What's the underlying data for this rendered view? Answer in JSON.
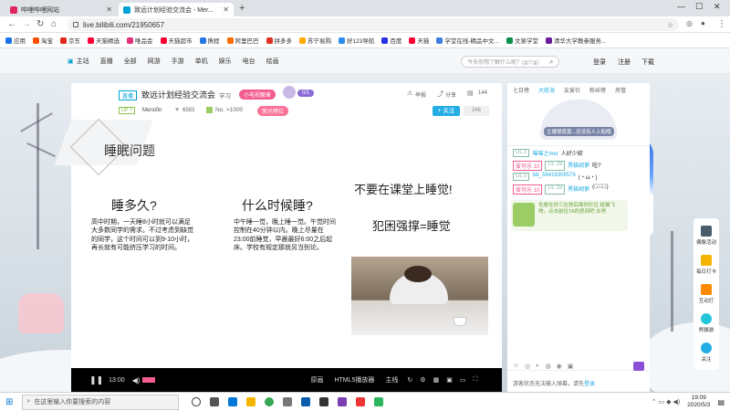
{
  "browser": {
    "tabs": [
      {
        "label": "哔哩哔哩网站",
        "favicon_color": "#e0245e",
        "active": false
      },
      {
        "label": "致远计划经验交流会 - Mer...",
        "favicon_color": "#00a1d6",
        "active": true
      }
    ],
    "new_tab": "+",
    "url": "live.bilibili.com/21950657",
    "bookmarks": [
      "应用",
      "淘宝",
      "京东",
      "天猫精选",
      "唯品会",
      "天猫超市",
      "携程",
      "阿里巴巴",
      "拼多多",
      "苏宁易购",
      "好123导航",
      "百度",
      "天猫",
      "学堂在线-精品中文...",
      "文泉学堂",
      "清华大学教参服务..."
    ]
  },
  "site_header": {
    "home": "主站",
    "links": [
      "直播",
      "全部",
      "网游",
      "手游",
      "单机",
      "娱乐",
      "电台",
      "绘画"
    ],
    "search_placeholder": "今天你想了解什么呢？(≧▽≦)",
    "login": "登录",
    "register": "注册",
    "download": "下载"
  },
  "room": {
    "tag": "直播",
    "title": "致远计划经验交流会",
    "category": "学习",
    "small_badge": "小电视徽章",
    "fan_count_label": "0/1",
    "report": "举报",
    "share": "分享",
    "share_count": "144",
    "up_level": "UP 7",
    "uploader": "Mersi0n",
    "fans": "6583",
    "rank": "No. >1000",
    "hot_label": "荣光榜位",
    "follow": "关注",
    "follow_count": "246"
  },
  "slide": {
    "title": "睡眠问题",
    "col1_head": "睡多久?",
    "col1_body": "高中时期，一天睡8小时就可以满足大多数同学的需求。不过考虑到缺觉的同学，这个时间可以到9-10小时，再长就有可能挤压学习的时间。",
    "col2_head": "什么时候睡?",
    "col2_body": "中午睡一觉，晚上睡一觉。午觉时间控制在40分钟以内。晚上尽量在23:00前睡觉，早晨最好6:00之后起床。学校有规定那就另当别论。",
    "col3_head": "不要在课堂上睡觉!",
    "col3_sub": "犯困强撑=睡觉"
  },
  "controls": {
    "time": "13:00",
    "quality": "原画",
    "html5": "HTML5播放器",
    "main_line": "主线"
  },
  "chat": {
    "tabs": [
      "七日榜",
      "大航海",
      "友爱社",
      "粉丝榜",
      "房管"
    ],
    "guard_hint": "主播很寂寞...还没有人上船哦",
    "messages": [
      {
        "level": "UL 1",
        "medal": "",
        "user": "喵喵之mer",
        "text": "人好少欸"
      },
      {
        "level": "",
        "medal": "爱可乐 10",
        "user2": "UL 19",
        "user": "黑猫胡萝",
        "text": "吃?"
      },
      {
        "level": "UL 0",
        "medal": "",
        "user": "bili_56416306576",
        "text": "(・ω・)"
      },
      {
        "level": "",
        "medal": "爱可乐 10",
        "user2": "UL 19",
        "user": "黑猫胡萝",
        "text": "(ﾟ∀ﾟ)"
      }
    ],
    "notice": "也是在你三在你后面你拦住 给猫飞吻，点击前往TA的房间吧 去吧",
    "send_hint": "游客状态无法输入弹幕，请先",
    "login_link": "登录"
  },
  "side_tools": [
    "偶像活动",
    "每日打卡",
    "互动打",
    "熊猫游",
    "关注"
  ],
  "taskbar": {
    "search": "在这里输入你要搜索的内容",
    "time": "19:09",
    "date": "2020/5/3"
  }
}
